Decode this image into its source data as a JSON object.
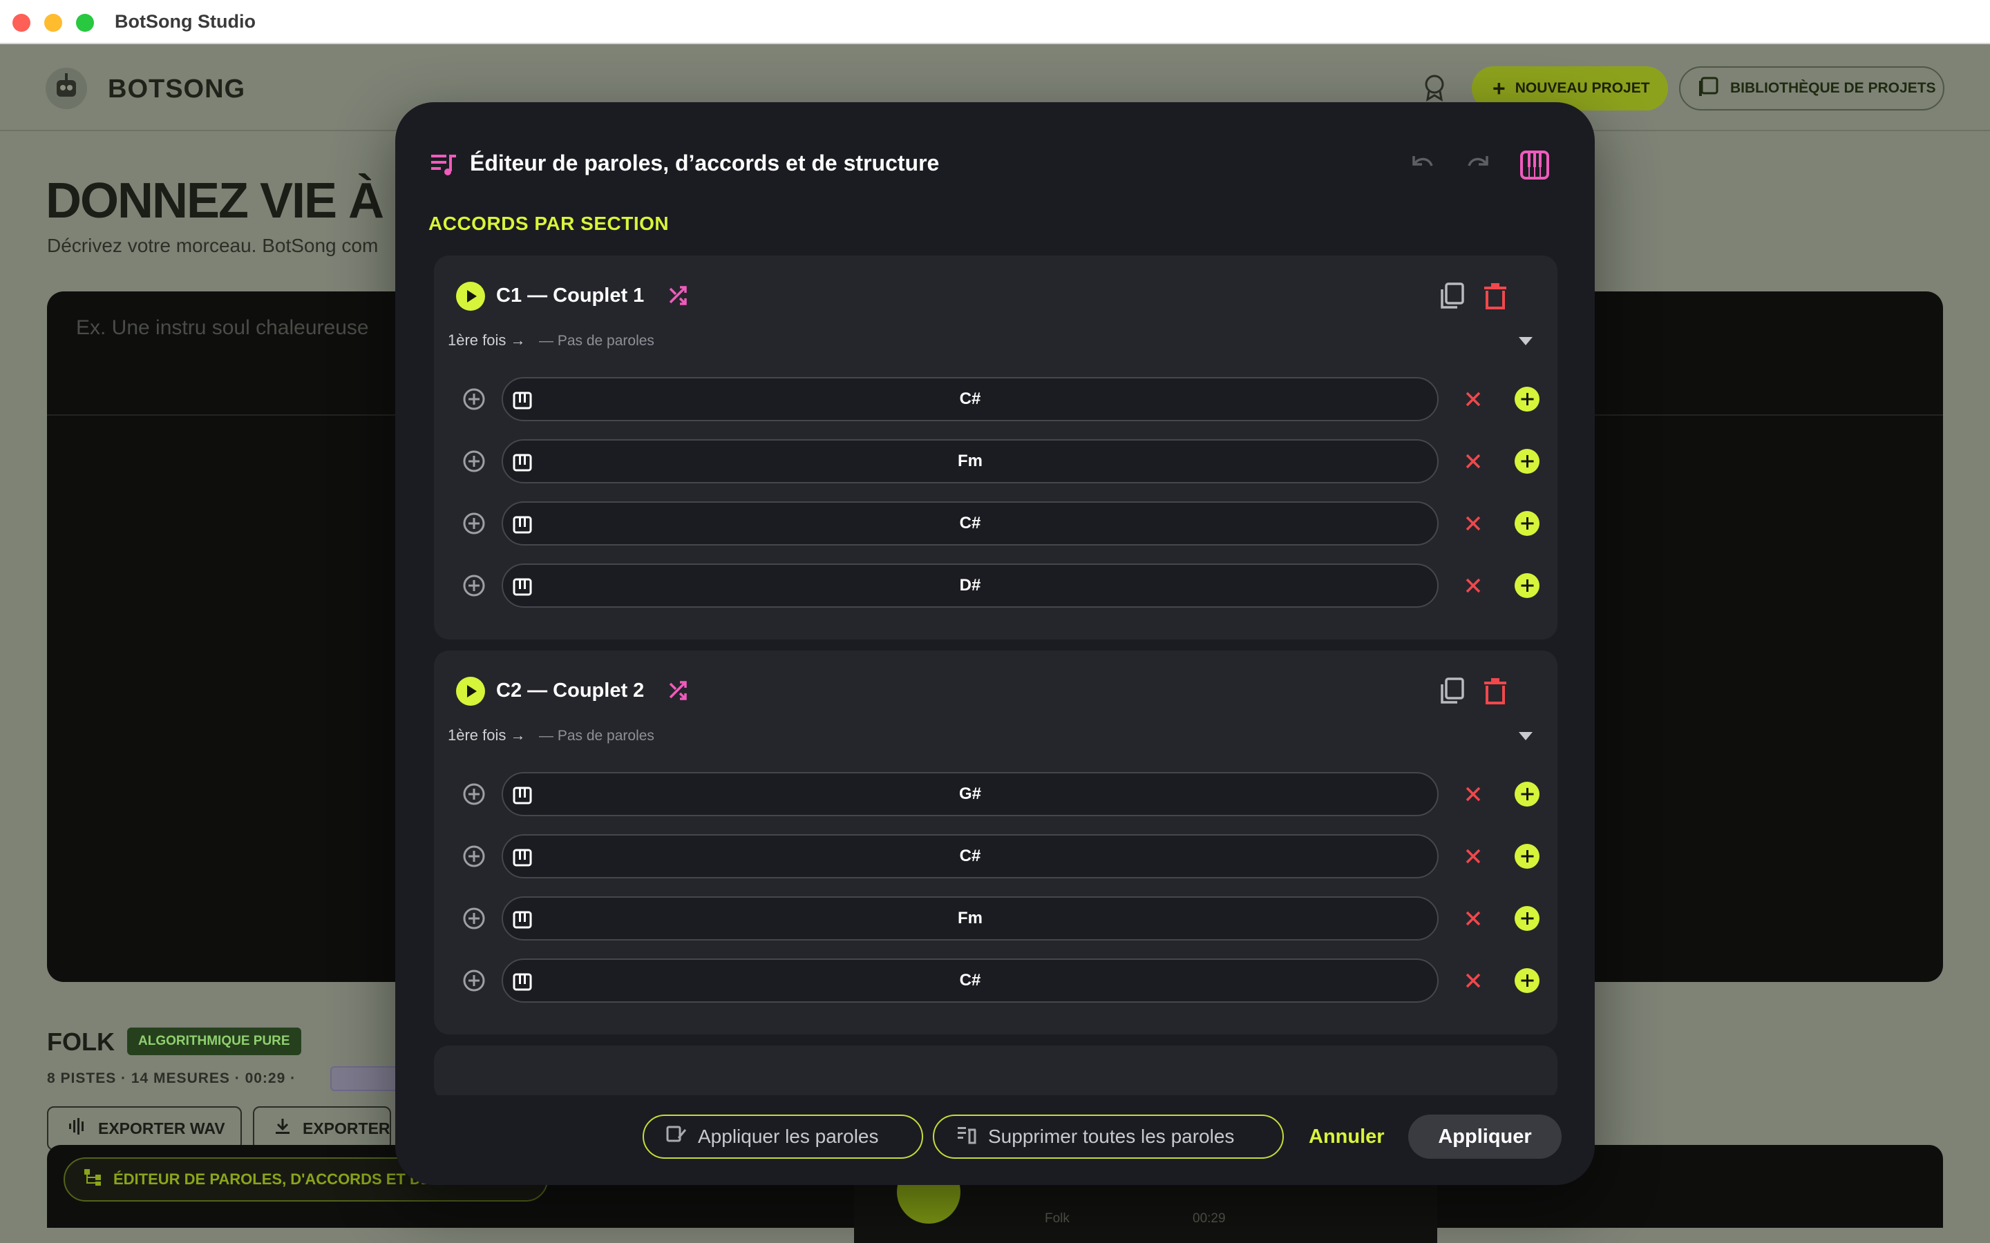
{
  "window": {
    "title": "BotSong Studio"
  },
  "app": {
    "logo_text": "BOTSONG",
    "new_project": "NOUVEAU PROJET",
    "project_library": "BIBLIOTHÈQUE DE PROJETS",
    "hero_title": "DONNEZ VIE À",
    "hero_subtitle": "Décrivez votre morceau. BotSong com",
    "prompt_placeholder": "Ex. Une instru soul chaleureuse",
    "genre": "FOLK",
    "genre_badge": "ALGORITHMIQUE PURE",
    "meta": "8 PISTES · 14 MESURES · 00:29 ·",
    "export_wav": "EXPORTER WAV",
    "export": "EXPORTER",
    "editor_button": "ÉDITEUR DE PAROLES, D'ACCORDS ET DE STRUCTURE",
    "player": {
      "genre": "Folk",
      "time": "00:29"
    }
  },
  "modal": {
    "title": "Éditeur de paroles, d’accords et de structure",
    "section_heading": "ACCORDS PAR SECTION",
    "sections": [
      {
        "title": "C1 — Couplet 1",
        "first_time": "1ère fois →",
        "lyrics_status": "— Pas de paroles",
        "chords": [
          "C#",
          "Fm",
          "C#",
          "D#"
        ]
      },
      {
        "title": "C2 — Couplet 2",
        "first_time": "1ère fois →",
        "lyrics_status": "— Pas de paroles",
        "chords": [
          "G#",
          "C#",
          "Fm",
          "C#"
        ]
      }
    ],
    "footer": {
      "apply_lyrics": "Appliquer les paroles",
      "clear_lyrics": "Supprimer toutes les paroles",
      "cancel": "Annuler",
      "apply": "Appliquer"
    }
  },
  "colors": {
    "accent": "#d6f43a",
    "pink": "#f05bbd",
    "danger": "#f0484c",
    "modal_bg": "#1b1c21",
    "card_bg": "#25262b"
  }
}
